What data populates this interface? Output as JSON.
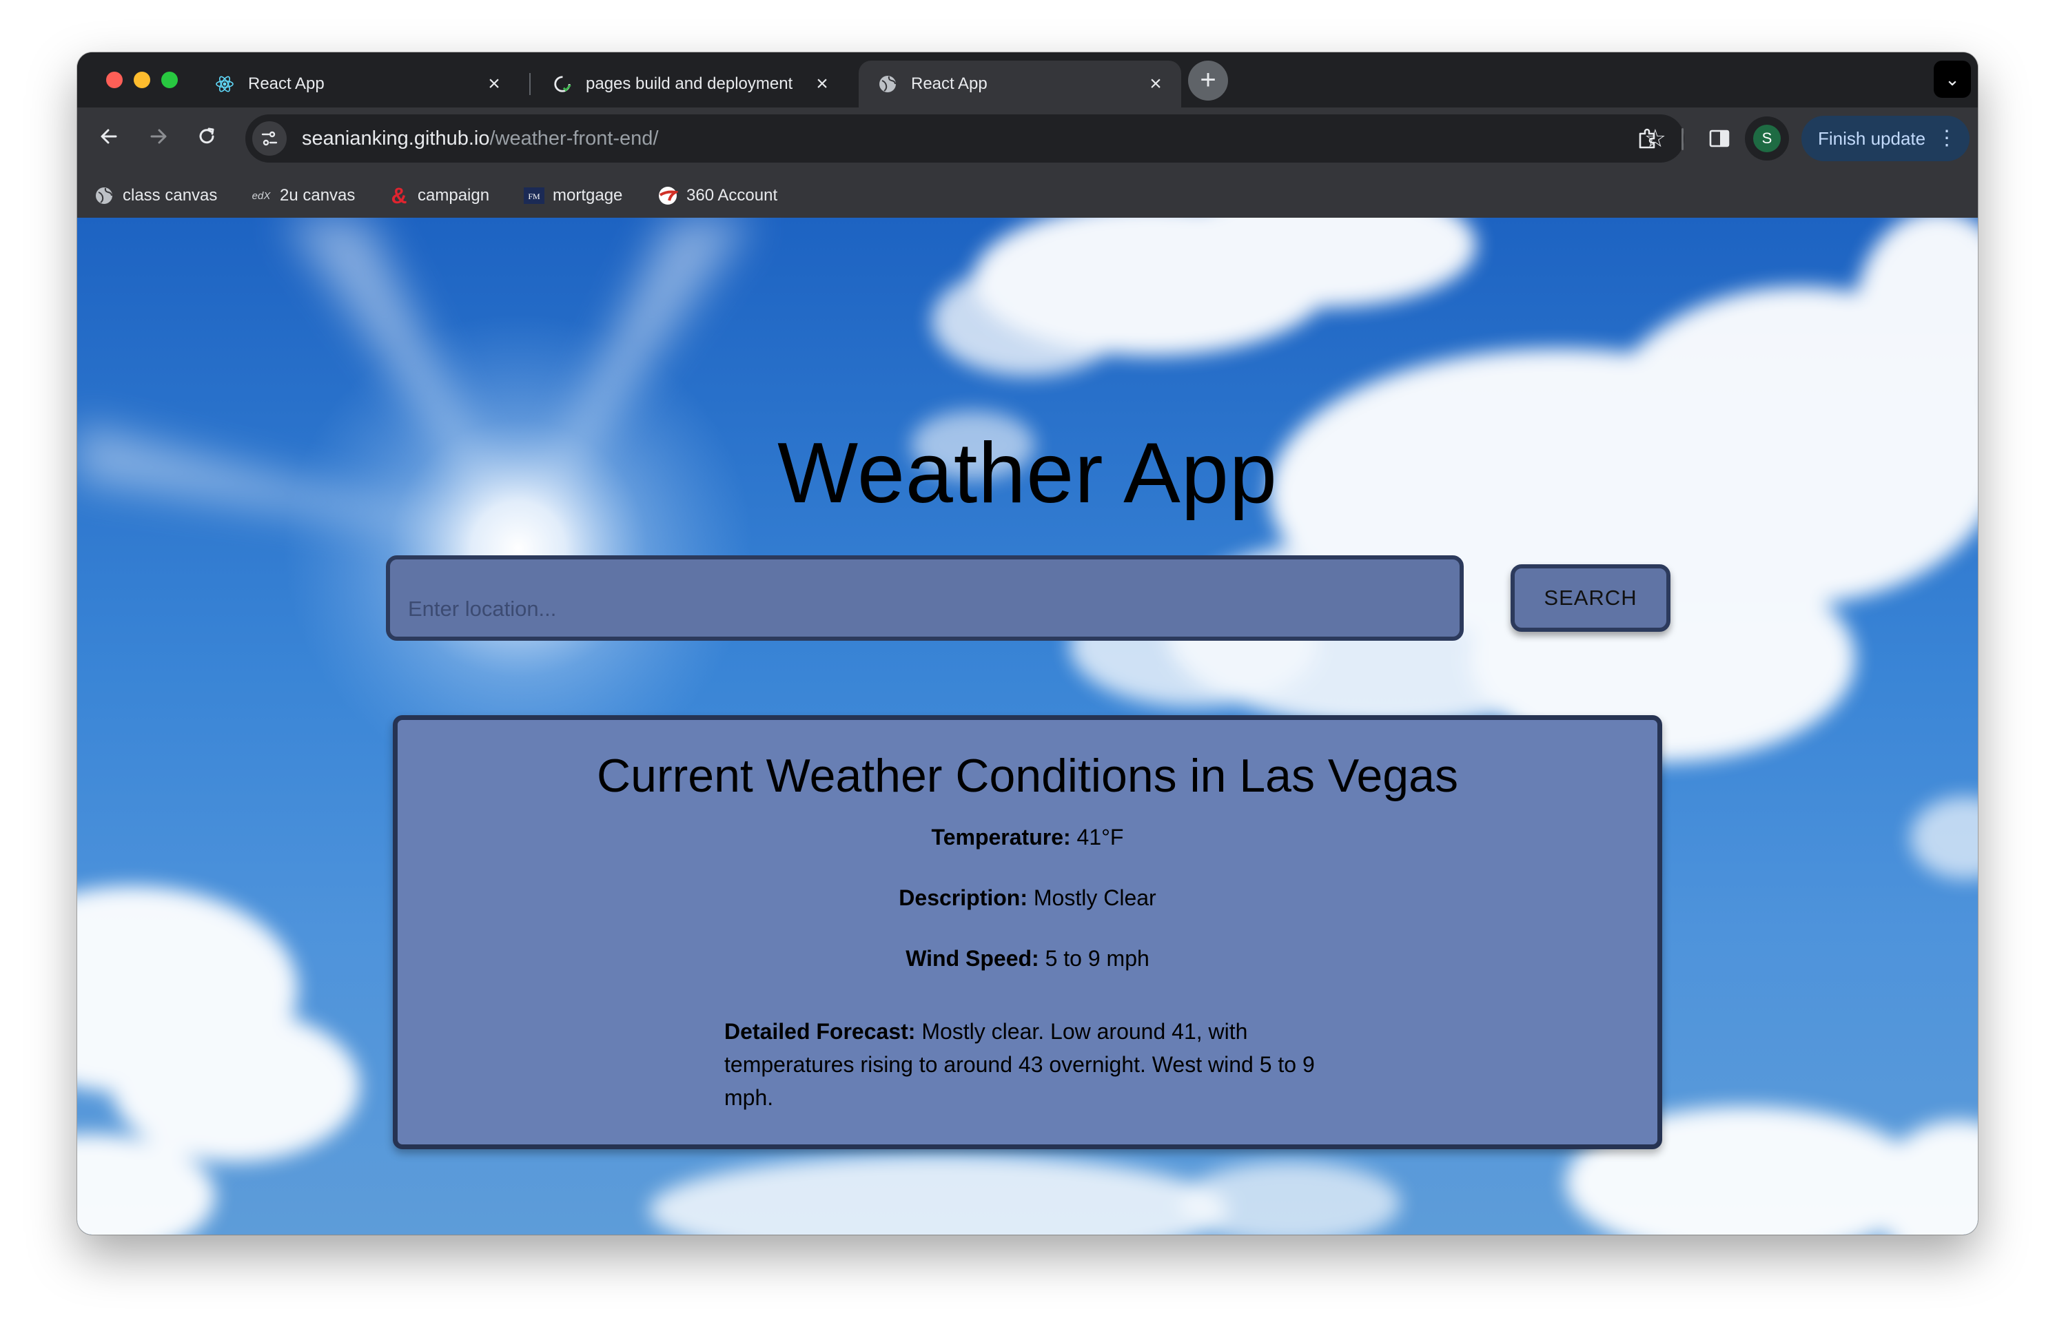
{
  "browser": {
    "tabs": [
      {
        "title": "React App",
        "icon": "react-icon",
        "active": false
      },
      {
        "title": "pages build and deployment",
        "icon": "github-icon",
        "active": false
      },
      {
        "title": "React App",
        "icon": "globe-icon",
        "active": true
      }
    ],
    "url": {
      "host": "seanianking.github.io",
      "path": "/weather-front-end/"
    },
    "finish_update_label": "Finish update",
    "profile_initial": "S",
    "bookmarks": [
      {
        "label": "class canvas",
        "icon": "globe-icon"
      },
      {
        "label": "2u canvas",
        "icon": "edx-icon"
      },
      {
        "label": "campaign",
        "icon": "ampersand-icon"
      },
      {
        "label": "mortgage",
        "icon": "fm-icon"
      },
      {
        "label": "360 Account",
        "icon": "capital-one-icon"
      }
    ]
  },
  "app": {
    "title": "Weather App",
    "search": {
      "placeholder": "Enter location...",
      "value": "",
      "button_label": "SEARCH"
    },
    "card": {
      "heading": "Current Weather Conditions in Las Vegas",
      "temperature_label": "Temperature:",
      "temperature_value": "41°F",
      "description_label": "Description:",
      "description_value": "Mostly Clear",
      "wind_label": "Wind Speed:",
      "wind_value": "5 to 9 mph",
      "forecast_label": "Detailed Forecast:",
      "forecast_value": "Mostly clear. Low around 41, with temperatures rising to around 43 overnight. West wind 5 to 9 mph."
    }
  },
  "colors": {
    "panel": "#6074a5",
    "card": "#687fb4",
    "border": "#2c3a5c",
    "accent_update": "#c2dafb"
  }
}
